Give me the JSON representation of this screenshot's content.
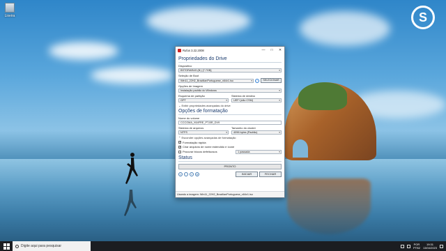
{
  "desktop": {
    "icon_label": "Lixeira"
  },
  "window": {
    "title": "Rufus 3.22.2008",
    "sections": {
      "drive": "Propriedades do Drive",
      "format": "Opções de formatação",
      "status": "Status"
    },
    "device": {
      "label": "Dispositivo",
      "value": "BSTORARAS (B:) [7.7GB]"
    },
    "boot": {
      "label": "Seleção de Boot",
      "value": "Win11_22H2_BrazilianPortuguese_x64v1.iso",
      "select_button": "SELECIONAR"
    },
    "image_option": {
      "label": "Opções de Imagem",
      "value": "Instalação padrão do Windows"
    },
    "partition": {
      "label": "Esquema de partição",
      "value": "GPT"
    },
    "target": {
      "label": "Sistema de destino",
      "value": "UEFI (não CSM)"
    },
    "advanced_drive_toggle": "Exibir propriedades avançadas do drive",
    "volume": {
      "label": "Nome do volume",
      "value": "CCCOMA_X64FRE_PT-BR_DV9"
    },
    "filesystem": {
      "label": "Sistema de arquivos",
      "value": "NTFS"
    },
    "cluster": {
      "label": "Tamanho do cluster",
      "value": "4096 bytes (Padrão)"
    },
    "advanced_format_toggle": "Esconder opções avançadas de formatação",
    "quick_format": "Formatação rápida",
    "extended_label": "Criar arquivos de nome estendido e ícone",
    "bad_blocks": "Procurar blocos defeituosos",
    "passes": "1 passada",
    "status_text": "PRONTO",
    "start_button": "INICIAR",
    "close_button": "FECHAR",
    "statusbar": "Usando a imagem: Win11_22H2_BrazilianPortuguese_x64v1.iso"
  },
  "taskbar": {
    "search_placeholder": "Digite aqui para pesquisar",
    "lang": "POR",
    "layout": "PTB2",
    "time": "19:31",
    "date": "13/04/2023"
  }
}
